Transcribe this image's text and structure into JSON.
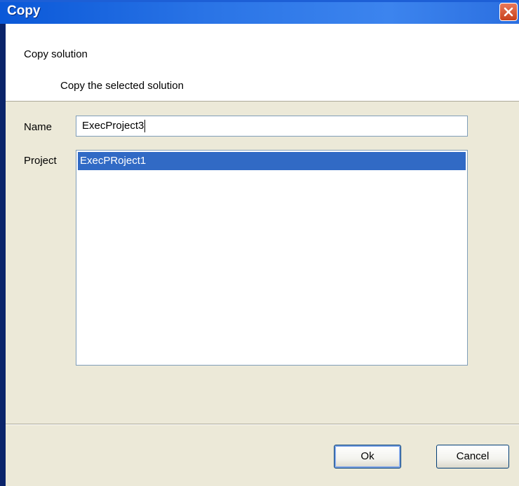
{
  "window": {
    "title": "Copy",
    "close_icon": "close-icon"
  },
  "header": {
    "title": "Copy solution",
    "description": "Copy the selected solution"
  },
  "form": {
    "name_label": "Name",
    "name_value": "ExecProject3",
    "project_label": "Project",
    "projects": [
      {
        "label": "ExecPRoject1",
        "selected": true
      }
    ]
  },
  "buttons": {
    "ok_label": "Ok",
    "cancel_label": "Cancel"
  },
  "colors": {
    "titlebar": "#2a74e6",
    "selection": "#316ac5",
    "dialog_bg": "#ece9d8",
    "close_button": "#c8411c"
  }
}
